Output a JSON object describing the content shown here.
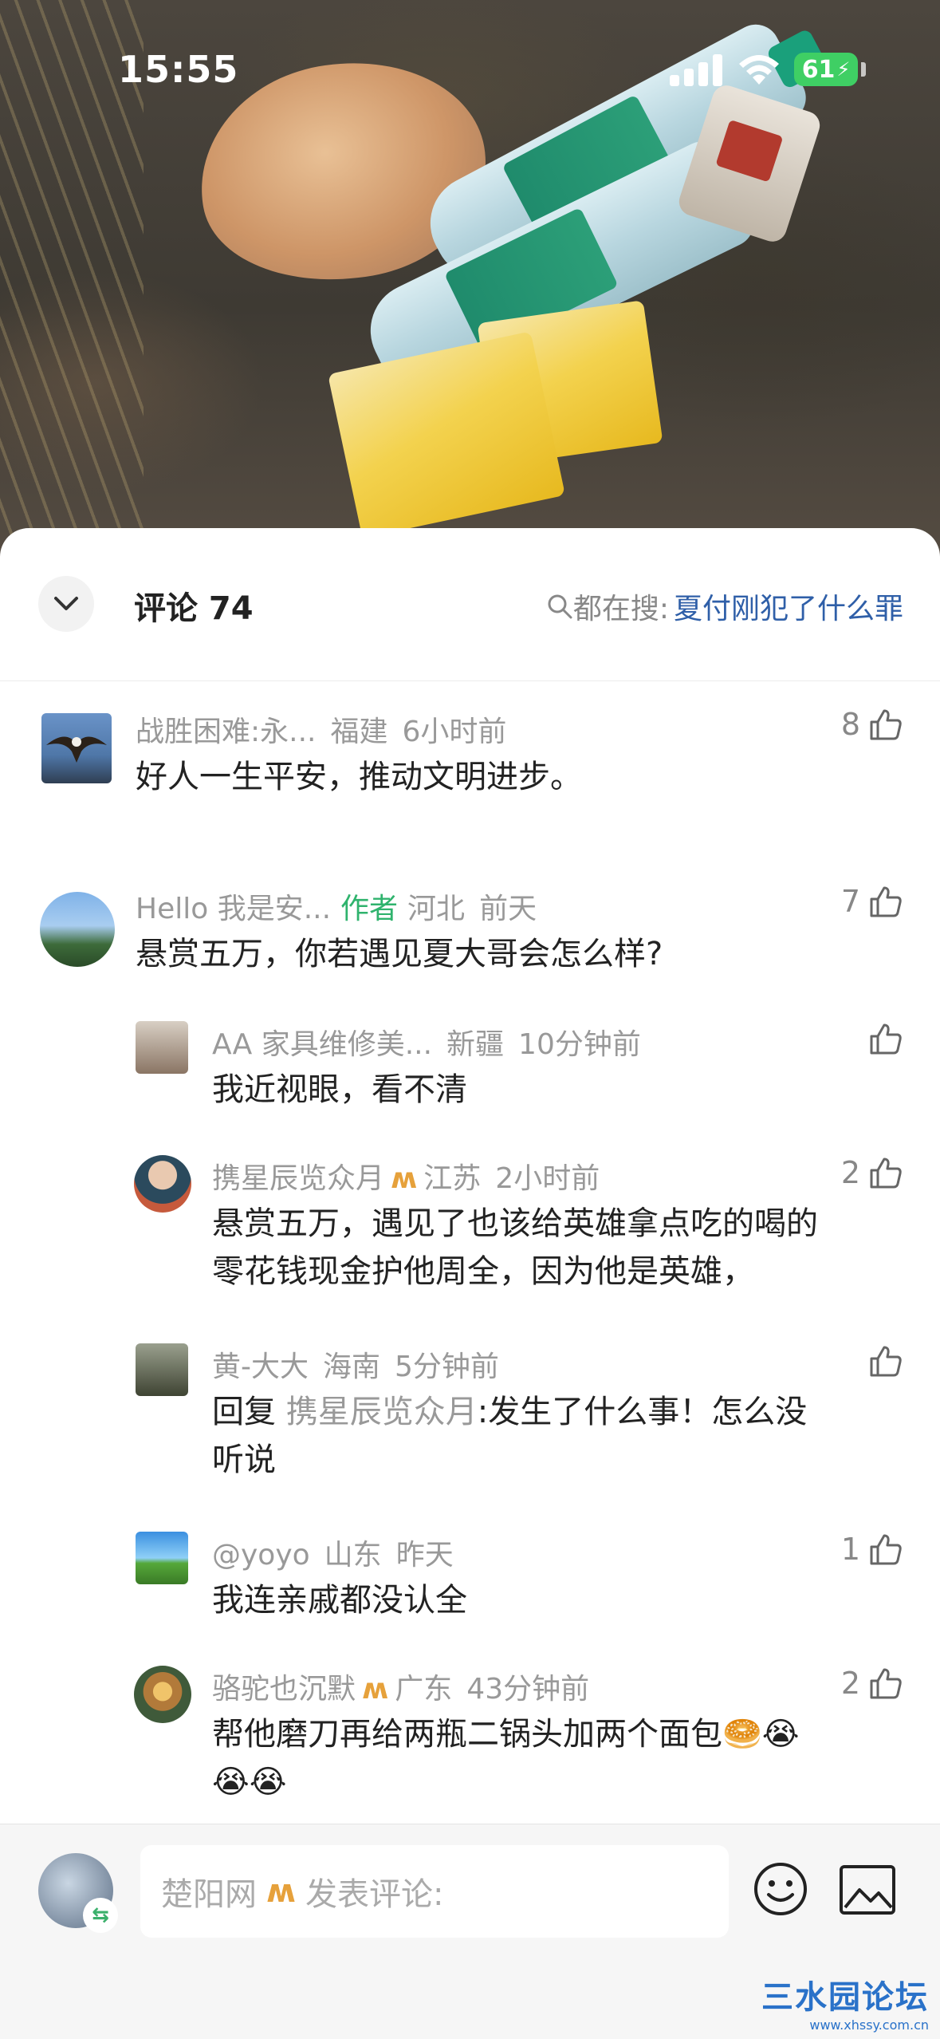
{
  "status_bar": {
    "time": "15:55",
    "battery": "61"
  },
  "header": {
    "title": "评论 74",
    "search_prefix": "都在搜:",
    "search_keyword": "夏付刚犯了什么罪"
  },
  "comments": [
    {
      "author": "战胜困难:永...",
      "region": "福建",
      "time": "6小时前",
      "likes": "8",
      "text": "好人一生平安，推动文明进步。"
    },
    {
      "author": "Hello 我是安...",
      "author_tag": "作者",
      "region": "河北",
      "time": "前天",
      "likes": "7",
      "text": "悬赏五万，你若遇见夏大哥会怎么样?"
    }
  ],
  "replies": [
    {
      "author": "AA 家具维修美...",
      "region": "新疆",
      "time": "10分钟前",
      "likes": "",
      "text": "我近视眼，看不清"
    },
    {
      "author": "携星辰览众月",
      "region": "江苏",
      "time": "2小时前",
      "likes": "2",
      "text_line1": "悬赏五万，遇见了也该给英雄拿点吃的喝的",
      "text_line2": "零花钱现金护他周全，因为他是英雄，"
    },
    {
      "author": "黄-大大",
      "region": "海南",
      "time": "5分钟前",
      "likes": "",
      "reply_prefix": "回复",
      "reply_to": "携星辰览众月",
      "text_line1": ":发生了什么事！怎么没",
      "text_line2": "听说"
    },
    {
      "author": "@yoyo",
      "region": "山东",
      "time": "昨天",
      "likes": "1",
      "text": "我连亲戚都没认全"
    },
    {
      "author": "骆驼也沉默",
      "region": "广东",
      "time": "43分钟前",
      "likes": "2",
      "text_line1": "帮他磨刀再给两瓶二锅头加两个面包🥯😭",
      "text_line2": "😭😭"
    }
  ],
  "composer": {
    "user": "楚阳网",
    "placeholder": "发表评论:"
  },
  "watermark": {
    "title": "三水园论坛",
    "url": "www.xhssy.com.cn"
  },
  "colors": {
    "author_tag": "#2fb36d",
    "badge": "#e6a13b",
    "keyword": "#2f5fa8"
  }
}
